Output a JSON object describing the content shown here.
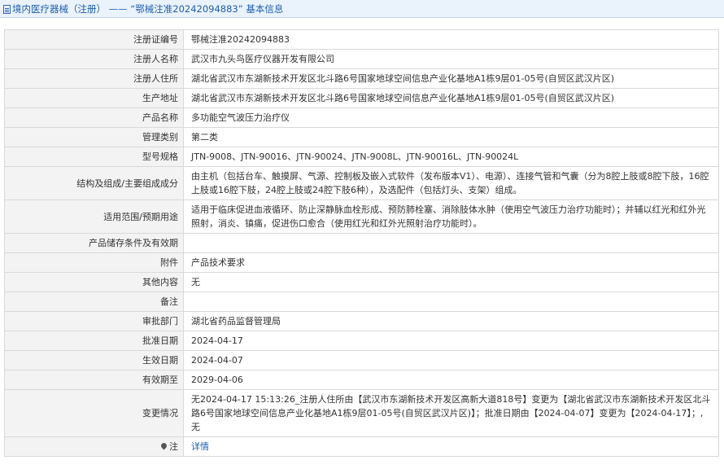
{
  "header": {
    "icon": "document-icon",
    "text": "境内医疗器械（注册） —— “鄂械注准20242094883” 基本信息"
  },
  "rows": [
    {
      "label": "注册证编号",
      "value": "鄂械注准20242094883"
    },
    {
      "label": "注册人名称",
      "value": "武汉市九头鸟医疗仪器开发有限公司"
    },
    {
      "label": "注册人住所",
      "value": "湖北省武汉市东湖新技术开发区北斗路6号国家地球空间信息产业化基地A1栋9层01-05号(自贸区武汉片区)"
    },
    {
      "label": "生产地址",
      "value": "湖北省武汉市东湖新技术开发区北斗路6号国家地球空间信息产业化基地A1栋9层01-05号(自贸区武汉片区)"
    },
    {
      "label": "产品名称",
      "value": "多功能空气波压力治疗仪"
    },
    {
      "label": "管理类别",
      "value": "第二类"
    },
    {
      "label": "型号规格",
      "value": "JTN-9008、JTN-90016、JTN-90024、JTN-9008L、JTN-90016L、JTN-90024L"
    },
    {
      "label": "结构及组成/主要组成成分",
      "value": "由主机（包括台车、触摸屏、气源、控制板及嵌入式软件（发布版本V1）、电源）、连接气管和气囊（分为8腔上肢或8腔下肢，16腔上肢或16腔下肢，24腔上肢或24腔下肢6种），及选配件（包括灯头、支架）组成。"
    },
    {
      "label": "适用范围/预期用途",
      "value": "适用于临床促进血液循环、防止深静脉血栓形成、预防肺栓塞、消除肢体水肿（使用空气波压力治疗功能时）；并辅以红光和红外光照射，消炎、镇痛，促进伤口愈合（使用红光和红外光照射治疗功能时）。"
    },
    {
      "label": "产品储存条件及有效期",
      "value": ""
    },
    {
      "label": "附件",
      "value": "产品技术要求"
    },
    {
      "label": "其他内容",
      "value": "无"
    },
    {
      "label": "备注",
      "value": ""
    },
    {
      "label": "审批部门",
      "value": "湖北省药品监督管理局"
    },
    {
      "label": "批准日期",
      "value": "2024-04-17"
    },
    {
      "label": "生效日期",
      "value": "2024-04-07"
    },
    {
      "label": "有效期至",
      "value": "2029-04-06"
    },
    {
      "label": "变更情况",
      "value": "无2024-04-17 15:13:26_注册人住所由【武汉市东湖新技术开发区高新大道818号】变更为【湖北省武汉市东湖新技术开发区北斗路6号国家地球空间信息产业化基地A1栋9层01-05号(自贸区武汉片区)】；批准日期由【2024-04-07】变更为【2024-04-17】；,无"
    }
  ],
  "note": {
    "icon": "pin-icon",
    "label": "注",
    "link_text": "详情"
  }
}
